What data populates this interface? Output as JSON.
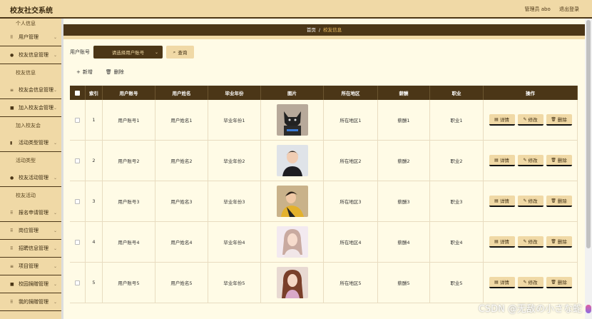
{
  "app": {
    "title": "校友社交系统"
  },
  "header": {
    "user_role": "管理员 abo",
    "logout": "退出登录"
  },
  "sidebar": {
    "items": [
      {
        "type": "sub",
        "label": "个人信息"
      },
      {
        "type": "group",
        "label": "用户管理",
        "icon": "grid-icon"
      },
      {
        "type": "group",
        "label": "校友信息管理",
        "icon": "user-icon"
      },
      {
        "type": "sub",
        "label": "校友信息"
      },
      {
        "type": "group",
        "label": "校友会信息管理",
        "icon": "list-icon"
      },
      {
        "type": "group",
        "label": "加入校友会管理",
        "icon": "square-icon"
      },
      {
        "type": "sub",
        "label": "加入校友会"
      },
      {
        "type": "group",
        "label": "活动类型管理",
        "icon": "bar-chart-icon"
      },
      {
        "type": "sub",
        "label": "活动类型"
      },
      {
        "type": "group",
        "label": "校友活动管理",
        "icon": "user-icon"
      },
      {
        "type": "sub",
        "label": "校友活动"
      },
      {
        "type": "group",
        "label": "报名申请管理",
        "icon": "grid-icon"
      },
      {
        "type": "group",
        "label": "岗位管理",
        "icon": "grid-icon"
      },
      {
        "type": "group",
        "label": "招聘信息管理",
        "icon": "grid-icon"
      },
      {
        "type": "group",
        "label": "项目管理",
        "icon": "list-icon"
      },
      {
        "type": "group",
        "label": "校园捐赠管理",
        "icon": "square-icon"
      },
      {
        "type": "group",
        "label": "我的捐赠管理",
        "icon": "grid-icon"
      }
    ]
  },
  "breadcrumb": {
    "home": "首页",
    "separator": "/",
    "current": "校友信息"
  },
  "search": {
    "label": "用户账号",
    "placeholder": "请选择用户账号",
    "button": "查询"
  },
  "toolbar": {
    "add": "新增",
    "delete": "删除"
  },
  "table": {
    "headers": [
      "索引",
      "用户账号",
      "用户姓名",
      "毕业年份",
      "图片",
      "所在地区",
      "薪酬",
      "职业",
      "操作"
    ],
    "rows": [
      {
        "index": "1",
        "account": "用户账号1",
        "name": "用户姓名1",
        "year": "毕业年份1",
        "region": "所在地区1",
        "salary": "薪酬1",
        "job": "职业1",
        "pic": "dog"
      },
      {
        "index": "2",
        "account": "用户账号2",
        "name": "用户姓名2",
        "year": "毕业年份2",
        "region": "所在地区2",
        "salary": "薪酬2",
        "job": "职业2",
        "pic": "boy"
      },
      {
        "index": "3",
        "account": "用户账号3",
        "name": "用户姓名3",
        "year": "毕业年份3",
        "region": "所在地区3",
        "salary": "薪酬3",
        "job": "职业3",
        "pic": "boy2"
      },
      {
        "index": "4",
        "account": "用户账号4",
        "name": "用户姓名4",
        "year": "毕业年份4",
        "region": "所在地区4",
        "salary": "薪酬4",
        "job": "职业4",
        "pic": "girl"
      },
      {
        "index": "5",
        "account": "用户账号5",
        "name": "用户姓名5",
        "year": "毕业年份5",
        "region": "所在地区5",
        "salary": "薪酬5",
        "job": "职业5",
        "pic": "girl2"
      }
    ],
    "ops": {
      "detail": "详情",
      "edit": "修改",
      "delete": "删除"
    }
  },
  "watermark": "CSDN @无敌の小さな蛇",
  "colors": {
    "accent": "#4b3617",
    "light": "#f0d9a6",
    "bg": "#fffbe6"
  }
}
